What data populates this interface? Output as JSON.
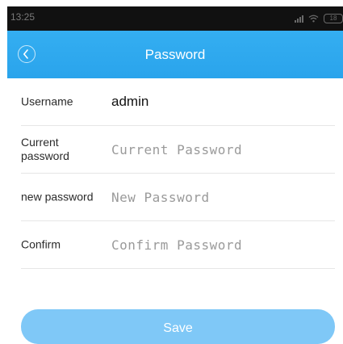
{
  "status_bar": {
    "time": "13:25",
    "battery": "18"
  },
  "header": {
    "title": "Password"
  },
  "form": {
    "rows": [
      {
        "label": "Username",
        "value": "admin"
      },
      {
        "label": "Current password",
        "placeholder": "Current Password",
        "value": ""
      },
      {
        "label": "new password",
        "placeholder": "New Password",
        "value": ""
      },
      {
        "label": "Confirm",
        "placeholder": "Confirm Password",
        "value": ""
      }
    ]
  },
  "actions": {
    "save_label": "Save"
  },
  "colors": {
    "header_bg": "#2aa4ec",
    "save_button_bg": "#7fc8f7",
    "status_bar_bg": "#111111"
  },
  "icons": {
    "back": "chevron-left-circle-icon",
    "signal": "signal-icon",
    "wifi": "wifi-icon",
    "battery": "battery-icon"
  }
}
